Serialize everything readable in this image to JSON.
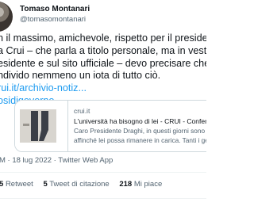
{
  "author": {
    "name": "Tomaso Montanari",
    "handle": "@tomasomontanari"
  },
  "tweet": {
    "lines": [
      "n il massimo, amichevole, rispetto per il presidente",
      "a Crui – che parla a titolo personale, ma in veste",
      "esidente e sul sito ufficiale – devo precisare che n",
      "ndivido nemmeno un iota di tutto ciò."
    ],
    "link": "rui.it/archivio-notiz...",
    "hashtag": "osidigoverno"
  },
  "card": {
    "domain": "crui.it",
    "title": "L'università ha bisogno di lei - CRUI - Conferenza dei Rettori",
    "description_lines": [
      "Caro Presidente Draghi, in questi giorni sono diversi gli app",
      "affinché lei possa rimanere in carica. Tanti i gesti di stima"
    ]
  },
  "meta": {
    "time_date": "M · 18 lug 2022",
    "source": "Twitter Web App"
  },
  "stats": {
    "retweets_count": "5",
    "retweets_label": "Retweet",
    "quotes_count": "5",
    "quotes_label": "Tweet di citazione",
    "likes_count": "218",
    "likes_label": "Mi piace"
  }
}
